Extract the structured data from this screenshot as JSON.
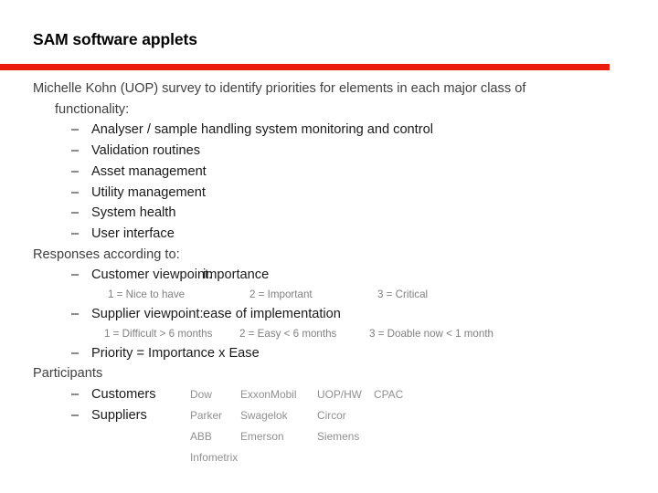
{
  "slide": {
    "title": "SAM software applets",
    "accent_color": "#ec1c0c",
    "body_text_color": "#3f3f3f",
    "muted_text_color": "#909090"
  },
  "intro": {
    "line": "Michelle Kohn (UOP) survey to identify priorities for elements in each major class of",
    "continuation": "functionality:"
  },
  "dash": "–",
  "functionality_items": [
    {
      "label": "Analyser / sample handling system monitoring and control"
    },
    {
      "label": "Validation routines"
    },
    {
      "label": "Asset management"
    },
    {
      "label": "Utility management"
    },
    {
      "label": "System health"
    },
    {
      "label": "User interface"
    }
  ],
  "responses": {
    "heading": "Responses according to:",
    "customer": {
      "label": "Customer viewpoint:",
      "value": "importance",
      "scale": [
        "1 = Nice to have",
        "2 = Important",
        "3 = Critical"
      ]
    },
    "supplier": {
      "label": "Supplier viewpoint:",
      "value": "ease of implementation",
      "scale": [
        "1 = Difficult > 6 months",
        "2 = Easy < 6 months",
        "3 = Doable now < 1 month"
      ]
    },
    "priority": "Priority = Importance x Ease"
  },
  "participants": {
    "heading": "Participants",
    "rows": [
      {
        "label": "Customers",
        "companies": [
          "Dow",
          "ExxonMobil",
          "UOP/HW",
          "CPAC"
        ]
      },
      {
        "label": "Suppliers",
        "companies": [
          "Parker",
          "Swagelok",
          "Circor"
        ]
      }
    ],
    "extra_rows": [
      {
        "companies": [
          "ABB",
          "Emerson",
          "Siemens"
        ]
      },
      {
        "companies": [
          "Infometrix"
        ]
      }
    ]
  }
}
